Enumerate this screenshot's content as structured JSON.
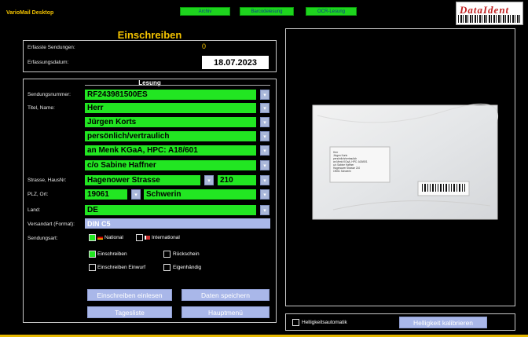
{
  "app": {
    "title": "VarioMail  Desktop",
    "top_buttons": [
      "Archiv",
      "Barcodelesung",
      "OCR-Lesung"
    ],
    "logo_text": "DataIdent"
  },
  "header": {
    "title": "Einschreiben"
  },
  "summary": {
    "count_label": "Erfasste Sendungen:",
    "count_value": "0",
    "date_label": "Erfassungsdatum:",
    "date_value": "18.07.2023"
  },
  "lesung": {
    "title": "Lesung",
    "labels": {
      "sendungsnummer": "Sendungsnummer:",
      "titel_name": "Titel, Name:",
      "strasse": "Strasse, HausNr:",
      "plz_ort": "PLZ, Ort:",
      "land": "Land:",
      "versandart": "Versandart (Format):",
      "sendungsart": "Sendungsart:"
    },
    "values": {
      "sendungsnummer": "RF243981500ES",
      "titel": "Herr",
      "name": "Jürgen Korts",
      "zeile3": "persönlich/vertraulich",
      "zeile4": "an Menk KGaA, HPC: A18/601",
      "zeile5": "c/o Sabine Haffner",
      "strasse": "Hagenower Strasse",
      "hausnr": "210",
      "plz": "19061",
      "ort": "Schwerin",
      "land": "DE",
      "versandart": "DIN C5"
    },
    "sendungsart": {
      "national": {
        "label": "National",
        "checked": true
      },
      "international": {
        "label": "International",
        "checked": false
      }
    },
    "options": {
      "einschreiben": {
        "label": "Einschreiben",
        "checked": true
      },
      "rueckschein": {
        "label": "Rückschein",
        "checked": false
      },
      "einwurf": {
        "label": "Einschreiben Einwurf",
        "checked": false
      },
      "eigenhaendig": {
        "label": "Eigenhändig",
        "checked": false
      }
    }
  },
  "actions": {
    "einlesen": "Einschreiben einlesen",
    "speichern": "Daten speichern",
    "tagesliste": "Tagesliste",
    "hauptmenue": "Hauptmenü"
  },
  "preview": {
    "auto_label": "Helligkeitsautomatik",
    "calibrate_label": "Helligkeit kalibrieren",
    "address_lines": [
      "Herr",
      "Jürgen Korts",
      "persönlich/vertraulich",
      "an Menk KGaA, HPC: A18/601",
      "c/o Sabine Haffner",
      "Hagenower Strasse 210",
      "19061 Schwerin"
    ]
  },
  "colors": {
    "accent_green": "#22e622",
    "accent_yellow": "#f5c400",
    "button_blue": "#a9b7e9"
  }
}
